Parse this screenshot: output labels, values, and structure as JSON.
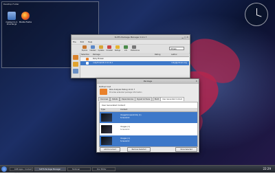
{
  "desktop": {
    "folder_view_title": "Desktop Folder",
    "icons": [
      {
        "label": "mypkg-0.1.2-linux.tar.gz",
        "icon": "archive-icon"
      },
      {
        "label": "Mozilla Firefox",
        "icon": "firefox-icon"
      }
    ]
  },
  "main_window": {
    "title": "SUITS Package Manager 0.11.7",
    "menu": [
      "File",
      "Edit",
      "Help"
    ],
    "toolbar": [
      "Explore",
      "Installed",
      "Updates",
      "Uninstall",
      "Ratings",
      "Info",
      "Preferences"
    ],
    "search_value": "rtfmbb",
    "columns": [
      "Selection",
      "Package",
      "Rating",
      "Author"
    ],
    "rows": [
      {
        "package": "Ruby Bowen",
        "rating": "",
        "author": ""
      },
      {
        "package": "rubyTimeInfo-0.11.6-1",
        "rating": "",
        "author": "ruby@johnwo.org"
      }
    ]
  },
  "dialog": {
    "title": "Package",
    "subtitle": "Defined Inst",
    "pkg_name": "Rule Analysis Debug v0.11.7",
    "pkg_desc": "Provides extended package information",
    "tabs": [
      "Overview",
      "Details",
      "Dependencies",
      "Signed Archives",
      "Build",
      "User Generated Content"
    ],
    "section_label": "User Generated Content",
    "columns": [
      "Type",
      "Content"
    ],
    "items": [
      {
        "title": "Image(Screenshots) (1)",
        "subtitle": "Screenshot"
      },
      {
        "title": "Images (1)",
        "subtitle": "Screenshot"
      },
      {
        "title": "Images (1)",
        "subtitle": "Screenshot"
      }
    ],
    "buttons": [
      "Add Document",
      "Remove Selected",
      "Show Selected"
    ]
  },
  "taskbar": {
    "tasks": [
      "KDE Apps - Contact Window",
      "SUITS Package Manager",
      "Terminal",
      "Doc Editor"
    ],
    "time": "22:29"
  },
  "colors": {
    "selection": "#3d78c9",
    "accent_orange": "#e9812b"
  }
}
